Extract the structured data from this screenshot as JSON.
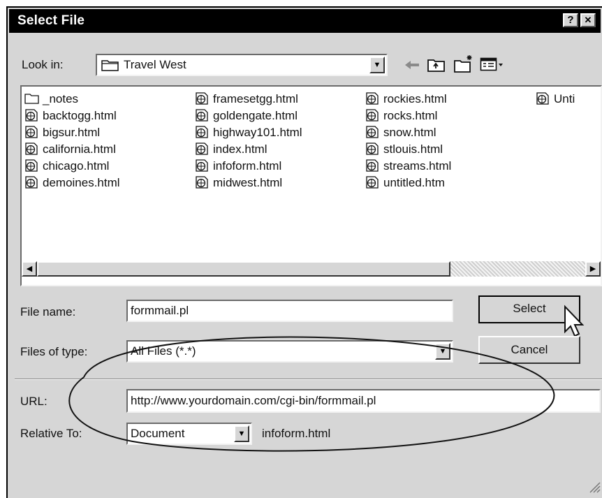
{
  "window": {
    "title": "Select File",
    "help_glyph": "?",
    "close_glyph": "✕"
  },
  "look_in": {
    "label": "Look in:",
    "value": "Travel West"
  },
  "toolbar": {
    "icons": [
      "back-arrow-icon",
      "up-folder-icon",
      "new-folder-icon",
      "view-menu-icon"
    ]
  },
  "files": {
    "columns": [
      [
        "_notes",
        "backtogg.html",
        "bigsur.html",
        "california.html",
        "chicago.html",
        "demoines.html"
      ],
      [
        "framesetgg.html",
        "goldengate.html",
        "highway101.html",
        "index.html",
        "infoform.html",
        "midwest.html"
      ],
      [
        "rockies.html",
        "rocks.html",
        "snow.html",
        "stlouis.html",
        "streams.html",
        "untitled.htm"
      ],
      [
        "Unti"
      ]
    ]
  },
  "file_name": {
    "label": "File name:",
    "value": "formmail.pl"
  },
  "files_of_type": {
    "label": "Files of type:",
    "value": "All Files (*.*)"
  },
  "buttons": {
    "select": "Select",
    "cancel": "Cancel"
  },
  "url": {
    "label": "URL:",
    "value": "http://www.yourdomain.com/cgi-bin/formmail.pl"
  },
  "relative_to": {
    "label": "Relative To:",
    "value": "Document",
    "file": "infoform.html"
  }
}
